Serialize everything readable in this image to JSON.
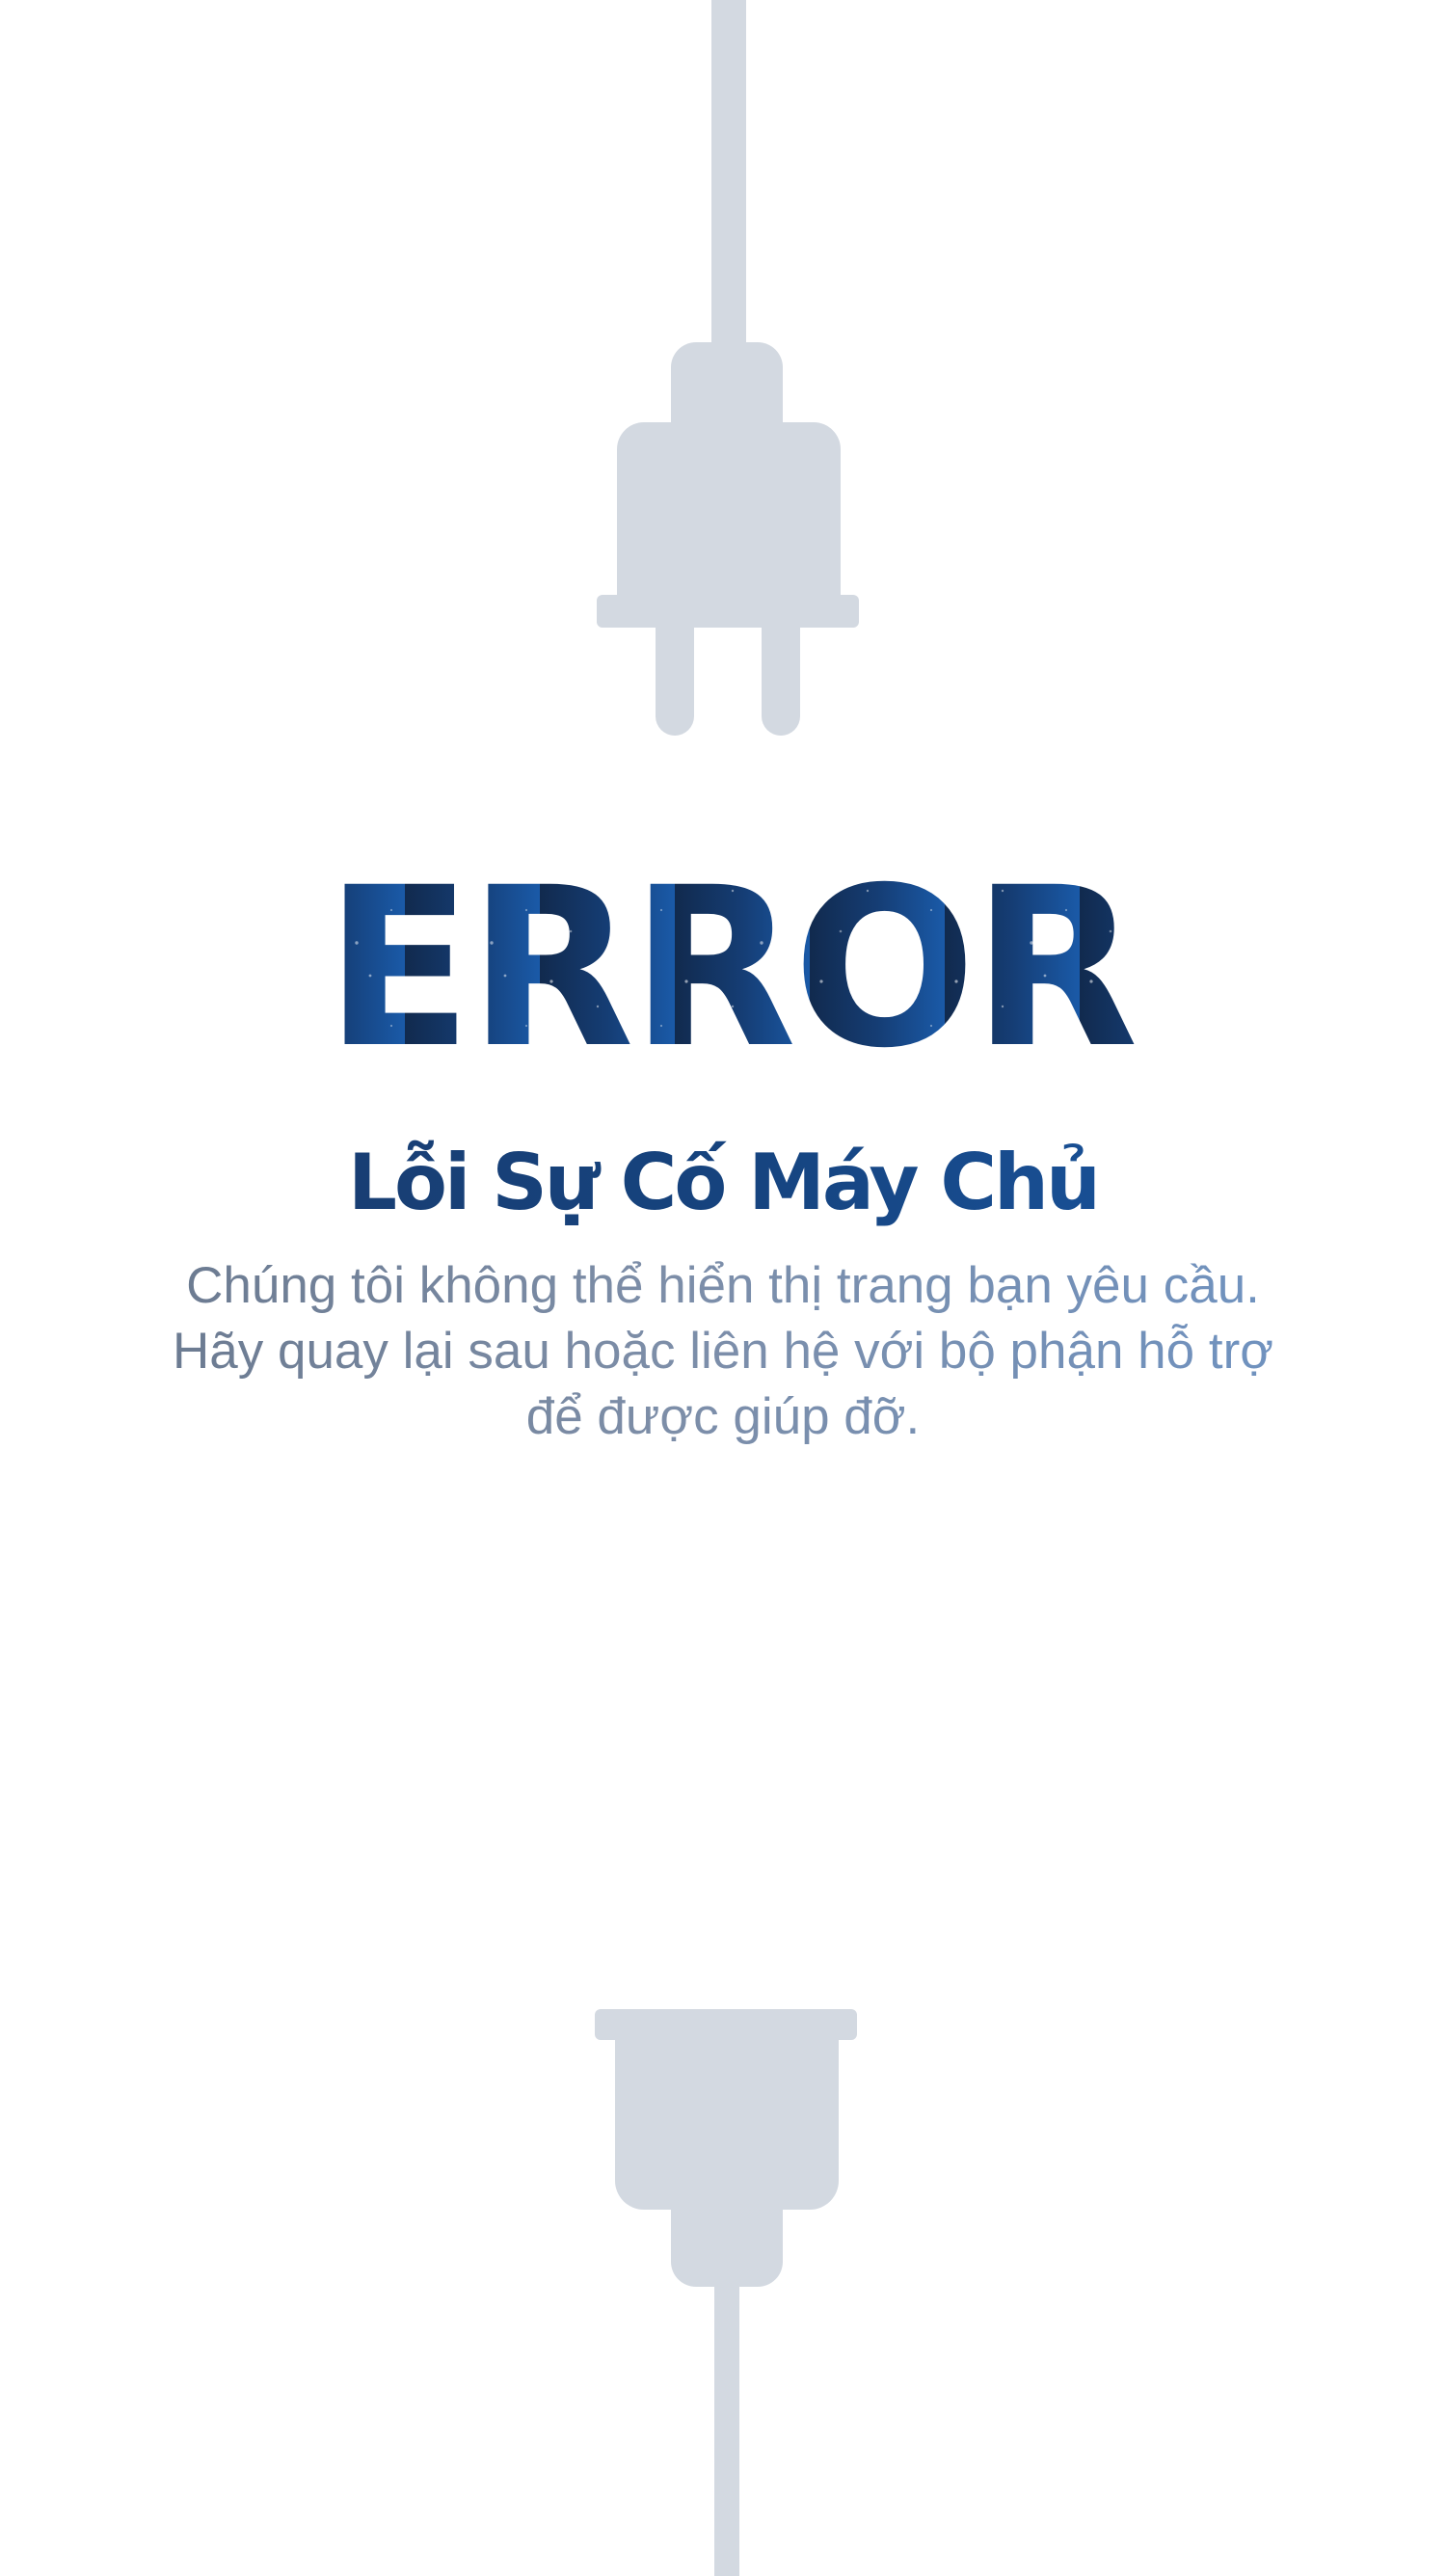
{
  "error": {
    "heading": "ERROR",
    "title": "Lỗi Sự Cố Máy Chủ",
    "message": "Chúng tôi không thể hiển thị trang bạn yêu cầu. Hãy quay lại sau hoặc liên hệ với bộ phận hỗ trợ để được giúp đỡ."
  },
  "icons": {
    "top": "power-plug-icon",
    "bottom": "power-socket-icon"
  },
  "colors": {
    "plug": "#d3d9e1",
    "heading_start": "#112a4e",
    "heading_end": "#1a5aa8",
    "title": "#16437e",
    "message": "#7487a3",
    "background": "#ffffff"
  }
}
